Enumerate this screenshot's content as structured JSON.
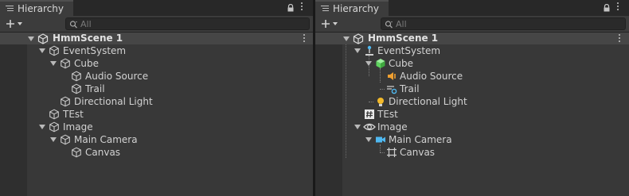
{
  "left": {
    "tab_label": "Hierarchy",
    "search_placeholder": "All",
    "scene_name": "HmmScene 1",
    "items": [
      {
        "label": "EventSystem",
        "icon": "gameobject-icon"
      },
      {
        "label": "Cube",
        "icon": "gameobject-icon"
      },
      {
        "label": "Audio Source",
        "icon": "gameobject-icon"
      },
      {
        "label": "Trail",
        "icon": "gameobject-icon"
      },
      {
        "label": "Directional Light",
        "icon": "gameobject-icon"
      },
      {
        "label": "TEst",
        "icon": "gameobject-icon"
      },
      {
        "label": "Image",
        "icon": "gameobject-icon"
      },
      {
        "label": "Main Camera",
        "icon": "gameobject-icon"
      },
      {
        "label": "Canvas",
        "icon": "gameobject-icon"
      }
    ]
  },
  "right": {
    "tab_label": "Hierarchy",
    "search_placeholder": "All",
    "scene_name": "HmmScene 1",
    "items": [
      {
        "label": "EventSystem",
        "icon": "event-system-icon"
      },
      {
        "label": "Cube",
        "icon": "cube-icon"
      },
      {
        "label": "Audio Source",
        "icon": "audio-source-icon"
      },
      {
        "label": "Trail",
        "icon": "trail-icon"
      },
      {
        "label": "Directional Light",
        "icon": "light-icon"
      },
      {
        "label": "TEst",
        "icon": "script-icon"
      },
      {
        "label": "Image",
        "icon": "eye-icon"
      },
      {
        "label": "Main Camera",
        "icon": "camera-icon"
      },
      {
        "label": "Canvas",
        "icon": "rect-transform-icon"
      }
    ]
  },
  "colors": {
    "panel_bg": "#383838",
    "scene_row_bg": "#464646",
    "cube_green": "#5fd35f",
    "audio_orange": "#f0a030",
    "camera_blue": "#4fb8f0",
    "light_yellow": "#f2b92a"
  }
}
